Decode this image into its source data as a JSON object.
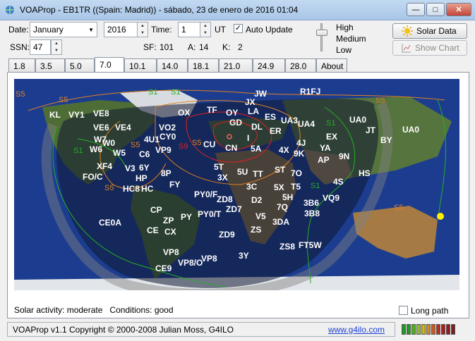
{
  "window": {
    "title": "VOAProp - EB1TR ((Spain: Madrid)) - sábado, 23 de enero de 2016 01:04"
  },
  "controls": {
    "date_label": "Date:",
    "month_value": "January",
    "year_value": "2016",
    "time_label": "Time:",
    "time_value": "1",
    "time_unit": "UT",
    "auto_update_label": "Auto Update",
    "auto_update_checked": true,
    "ssn_label": "SSN:",
    "ssn_value": "47",
    "sf_label": "SF:",
    "sf_value": "101",
    "a_label": "A:",
    "a_value": "14",
    "k_label": "K:",
    "k_value": "2",
    "power_levels": [
      "High",
      "Medium",
      "Low"
    ],
    "power_selected": "High",
    "solar_data_button": "Solar Data",
    "show_chart_button": "Show Chart"
  },
  "tabs": [
    "1.8",
    "3.5",
    "5.0",
    "7.0",
    "10.1",
    "14.0",
    "18.1",
    "21.0",
    "24.9",
    "28.0",
    "About"
  ],
  "active_tab": "7.0",
  "map": {
    "prefixes": [
      {
        "t": "JW"
      },
      {
        "t": "R1FJ"
      },
      {
        "t": "JX"
      },
      {
        "t": "VE8"
      },
      {
        "t": "KL"
      },
      {
        "t": "VY1"
      },
      {
        "t": "OX"
      },
      {
        "t": "TF"
      },
      {
        "t": "OY"
      },
      {
        "t": "LA"
      },
      {
        "t": "GD"
      },
      {
        "t": "ES"
      },
      {
        "t": "UA3"
      },
      {
        "t": "UA4"
      },
      {
        "t": "DL"
      },
      {
        "t": "ER"
      },
      {
        "t": "UA0"
      },
      {
        "t": "JT"
      },
      {
        "t": "UA0"
      },
      {
        "t": "VE6"
      },
      {
        "t": "VE4"
      },
      {
        "t": "VO2"
      },
      {
        "t": "CY0"
      },
      {
        "t": "W7"
      },
      {
        "t": "W0"
      },
      {
        "t": "4U1"
      },
      {
        "t": "VP9"
      },
      {
        "t": "CU"
      },
      {
        "t": "CN"
      },
      {
        "t": "I"
      },
      {
        "t": "5A"
      },
      {
        "t": "4X"
      },
      {
        "t": "4J"
      },
      {
        "t": "EX"
      },
      {
        "t": "BY"
      },
      {
        "t": "W6"
      },
      {
        "t": "W5"
      },
      {
        "t": "C6"
      },
      {
        "t": "9K"
      },
      {
        "t": "YA"
      },
      {
        "t": "AP"
      },
      {
        "t": "9N"
      },
      {
        "t": "XF4"
      },
      {
        "t": "V3"
      },
      {
        "t": "6Y"
      },
      {
        "t": "5T"
      },
      {
        "t": "5U"
      },
      {
        "t": "TT"
      },
      {
        "t": "ST"
      },
      {
        "t": "7O"
      },
      {
        "t": "HS"
      },
      {
        "t": "FO/C"
      },
      {
        "t": "HP"
      },
      {
        "t": "8P"
      },
      {
        "t": "3X"
      },
      {
        "t": "FY"
      },
      {
        "t": "4S"
      },
      {
        "t": "HC8"
      },
      {
        "t": "HC"
      },
      {
        "t": "3C"
      },
      {
        "t": "5X"
      },
      {
        "t": "T5"
      },
      {
        "t": "5H"
      },
      {
        "t": "3B6"
      },
      {
        "t": "VQ9"
      },
      {
        "t": "PY0/F"
      },
      {
        "t": "ZD8"
      },
      {
        "t": "D2"
      },
      {
        "t": "ZD7"
      },
      {
        "t": "7Q"
      },
      {
        "t": "3B8"
      },
      {
        "t": "CP"
      },
      {
        "t": "ZP"
      },
      {
        "t": "PY"
      },
      {
        "t": "PY0/T"
      },
      {
        "t": "V5"
      },
      {
        "t": "3DA"
      },
      {
        "t": "CE0A"
      },
      {
        "t": "CE"
      },
      {
        "t": "CX"
      },
      {
        "t": "ZS"
      },
      {
        "t": "ZD9"
      },
      {
        "t": "ZS8"
      },
      {
        "t": "FT5W"
      },
      {
        "t": "VP8"
      },
      {
        "t": "3Y"
      },
      {
        "t": "VP8/O"
      },
      {
        "t": "VP8"
      },
      {
        "t": "CE9"
      }
    ],
    "signal_labels": [
      "S5",
      "S5",
      "S1",
      "S5",
      "S5",
      "S9",
      "S5",
      "S5",
      "S1",
      "S1",
      "S5",
      "S1",
      "S1"
    ]
  },
  "status": {
    "solar_activity_label": "Solar activity:",
    "solar_activity": "moderate",
    "conditions_label": "Conditions:",
    "conditions": "good",
    "long_path_label": "Long path",
    "long_path_checked": false
  },
  "footer": {
    "version": "VOAProp v1.1",
    "copyright": "Copyright © 2000-2008 Julian Moss, G4ILO",
    "link": "www.g4ilo.com",
    "meter_colors": [
      "#1f9a1f",
      "#1f9a1f",
      "#4fae1f",
      "#8fbf1f",
      "#c9b21f",
      "#d08a1f",
      "#c85a1f",
      "#b82e1f",
      "#a81f1f",
      "#8f1f1f",
      "#7a1f1f"
    ]
  },
  "colors": {
    "contour_orange": "#e08020",
    "contour_green": "#22b022",
    "contour_red": "#e02020",
    "night": "#1a2340"
  }
}
